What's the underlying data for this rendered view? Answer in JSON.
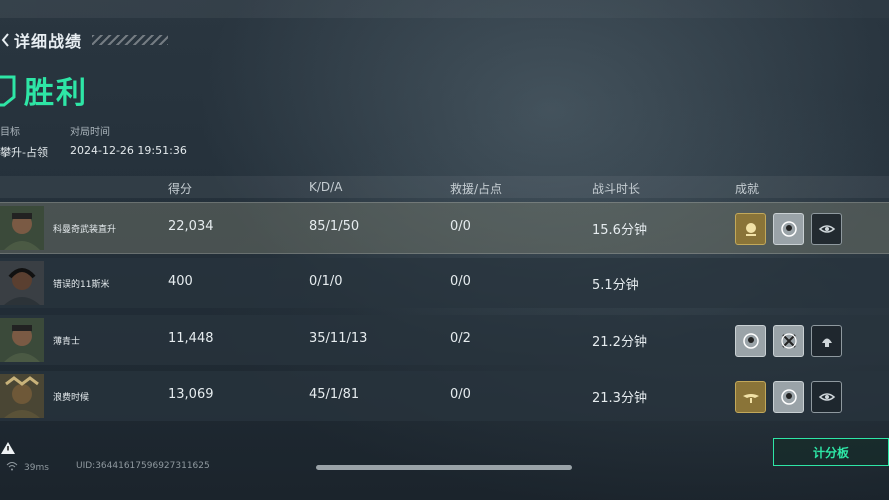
{
  "header": {
    "title": "详细战绩"
  },
  "result": {
    "text": "胜利"
  },
  "meta": {
    "objective_label": "目标",
    "objective_value": "攀升-占领",
    "time_label": "对局时间",
    "time_value": "2024-12-26 19:51:36"
  },
  "columns": {
    "score": "得分",
    "kda": "K/D/A",
    "rescue": "救援/占点",
    "duration": "战斗时长",
    "achievements": "成就"
  },
  "players": [
    {
      "name": "科曼奇武装直升",
      "score": "22,034",
      "kda": "85/1/50",
      "rescue": "0/0",
      "duration": "15.6分钟",
      "badges": [
        "gold-rose-badge-icon",
        "silver-skull-badge-icon",
        "dark-eye-badge-icon"
      ]
    },
    {
      "name": "错误的11斯米",
      "score": "400",
      "kda": "0/1/0",
      "rescue": "0/0",
      "duration": "5.1分钟",
      "badges": []
    },
    {
      "name": "薄青士",
      "score": "11,448",
      "kda": "35/11/13",
      "rescue": "0/2",
      "duration": "21.2分钟",
      "badges": [
        "silver-skull-badge-icon",
        "silver-crossed-rifles-badge-icon",
        "dark-helmet-badge-icon"
      ]
    },
    {
      "name": "浪费时候",
      "score": "13,069",
      "kda": "45/1/81",
      "rescue": "0/0",
      "duration": "21.3分钟",
      "badges": [
        "gold-wings-badge-icon",
        "silver-skull-badge-icon",
        "dark-eye-badge-icon"
      ]
    }
  ],
  "footer": {
    "ping": "39ms",
    "uid": "UID:3644161759692731162​5",
    "scoreboard_button": "计分板"
  },
  "colors": {
    "accent": "#2ee6a6",
    "gold": "#8a7438",
    "silver": "#9aa3a8"
  }
}
